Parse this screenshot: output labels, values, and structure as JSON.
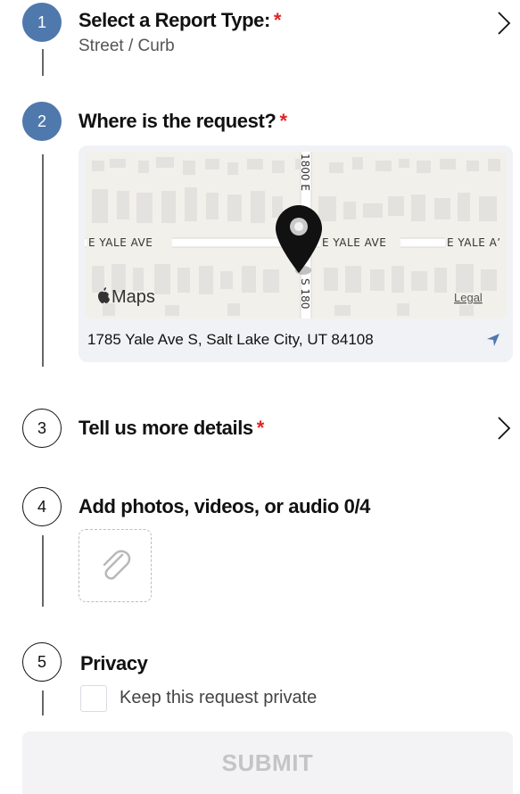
{
  "steps": [
    {
      "number": "1",
      "title": "Select a Report Type:",
      "required": "*",
      "subtitle": "Street / Curb"
    },
    {
      "number": "2",
      "title": "Where is the request?",
      "required": "*"
    },
    {
      "number": "3",
      "title": "Tell us more details",
      "required": "*"
    },
    {
      "number": "4",
      "title": "Add photos, videos, or audio 0/4"
    },
    {
      "number": "5",
      "title": "Privacy"
    }
  ],
  "map": {
    "street_labels": [
      "E YALE AVE",
      "E YALE AVE",
      "E YALE A’"
    ],
    "vertical_street_top": "1800 E",
    "vertical_street_bottom": "S 180",
    "brand": "Maps",
    "legal": "Legal",
    "address": "1785 Yale Ave S, Salt Lake City, UT 84108"
  },
  "privacy": {
    "checkbox_label": "Keep this request private"
  },
  "submit_label": "SUBMIT",
  "colors": {
    "accent": "#4f78ad",
    "required": "#e02424",
    "location_icon": "#4f78ad"
  }
}
